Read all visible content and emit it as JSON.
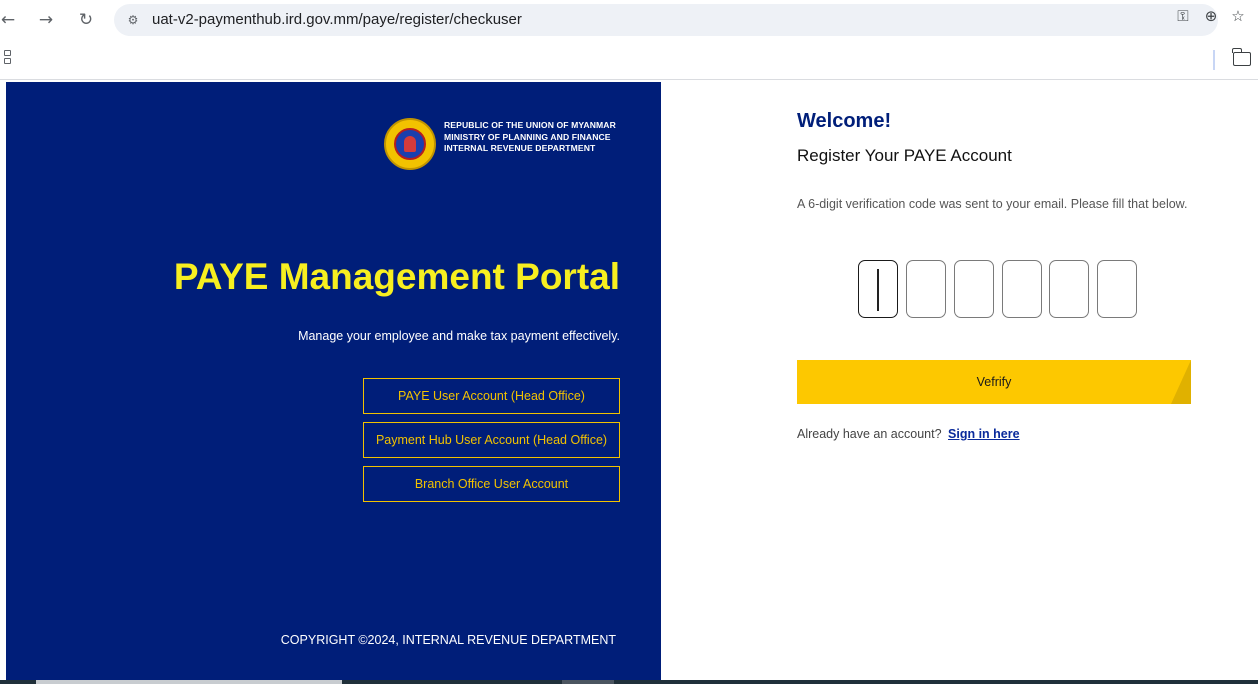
{
  "browser": {
    "url": "uat-v2-paymenthub.ird.gov.mm/paye/register/checkuser",
    "back_icon": "arrow-left-icon",
    "forward_icon": "arrow-right-icon",
    "reload_icon": "reload-icon",
    "site_info_icon": "tune-icon",
    "password_icon": "key-icon",
    "zoom_icon": "zoom-icon",
    "bookmark_icon": "star-icon",
    "apps_icon": "apps-icon",
    "folder_icon": "folder-icon"
  },
  "left_panel": {
    "background_color": "#001e79",
    "ministry_lines": [
      "REPUBLIC OF THE UNION OF MYANMAR",
      "MINISTRY OF PLANNING AND FINANCE",
      "INTERNAL REVENUE DEPARTMENT"
    ],
    "title": "PAYE Management Portal",
    "title_color": "#f7ef20",
    "subtitle": "Manage your employee and make tax payment effectively.",
    "account_buttons": [
      "PAYE User Account (Head Office)",
      "Payment Hub User Account (Head Office)",
      "Branch Office User Account"
    ],
    "copyright": "COPYRIGHT ©2024, INTERNAL REVENUE DEPARTMENT"
  },
  "right_panel": {
    "welcome": "Welcome!",
    "heading": "Register Your PAYE Account",
    "instruction": "A 6-digit verification code was sent to your email. Please fill that below.",
    "code_digits": [
      "",
      "",
      "",
      "",
      "",
      ""
    ],
    "verify_label": "Vefrify",
    "verify_color": "#fdc800",
    "signin_prompt": "Already have an account?",
    "signin_link": "Sign in here"
  }
}
